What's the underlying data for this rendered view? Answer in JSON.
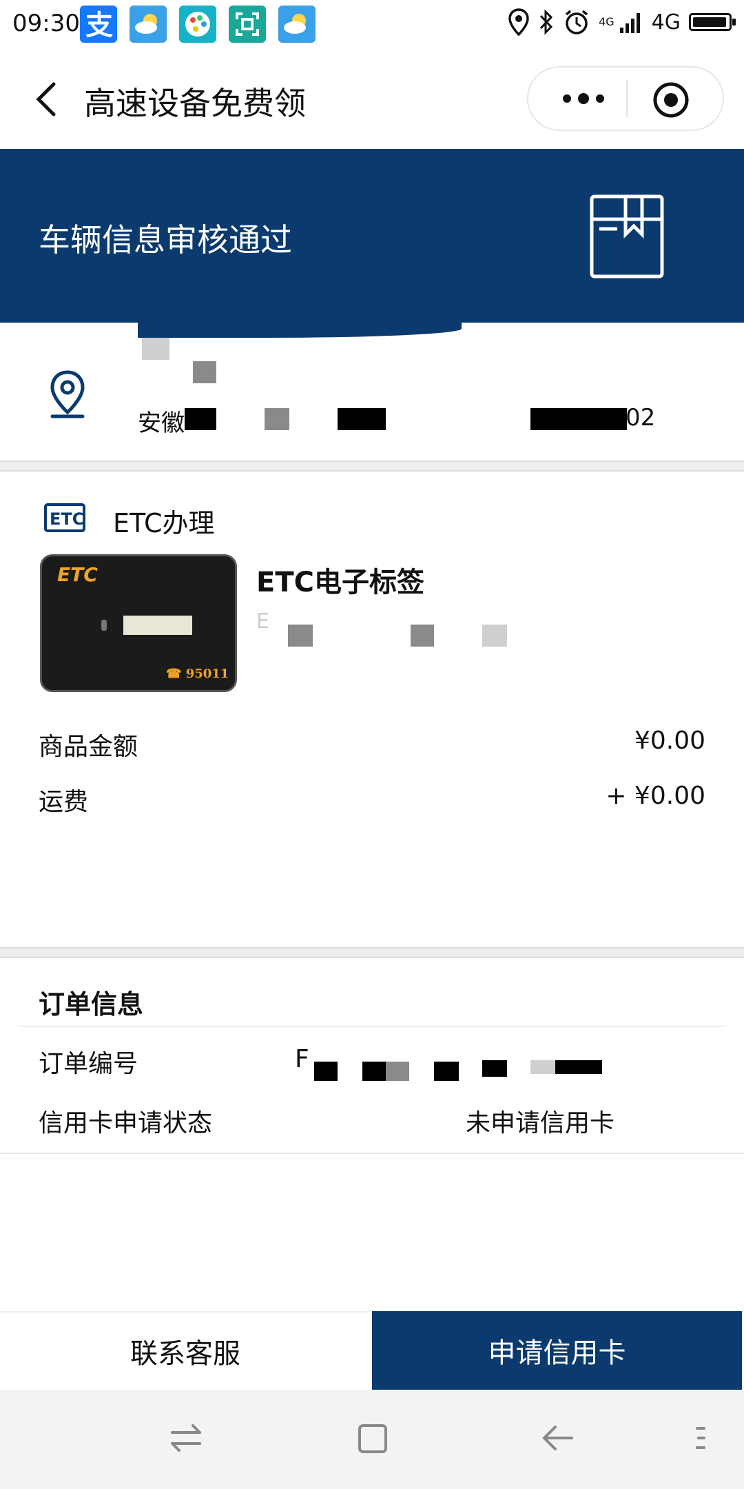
{
  "status_bar": {
    "time": "09:30",
    "network_small": "4G",
    "network": "4G",
    "battery_level": 0.95,
    "app_icons": [
      "alipay-icon",
      "weather-icon",
      "palette-icon",
      "scan-icon",
      "weather-icon"
    ]
  },
  "navbar": {
    "title": "高速设备免费领"
  },
  "banner": {
    "title": "车辆信息审核通过"
  },
  "address": {
    "line2_prefix": "安徽",
    "line2_suffix": "02"
  },
  "etc": {
    "service_label": "ETC办理",
    "product_name": "ETC电子标签",
    "product_sub_prefix": "E",
    "device_logo": "ETC",
    "device_phone": "☎ 95011",
    "price_label": "商品金额",
    "price_value": "¥0.00",
    "shipping_label": "运费",
    "shipping_value": "+ ¥0.00"
  },
  "order": {
    "title": "订单信息",
    "number_label": "订单编号",
    "number_prefix": "F",
    "card_status_label": "信用卡申请状态",
    "card_status_value": "未申请信用卡"
  },
  "actions": {
    "contact": "联系客服",
    "apply": "申请信用卡"
  },
  "colors": {
    "brand": "#0b3a6e",
    "device_accent": "#f0a326"
  }
}
